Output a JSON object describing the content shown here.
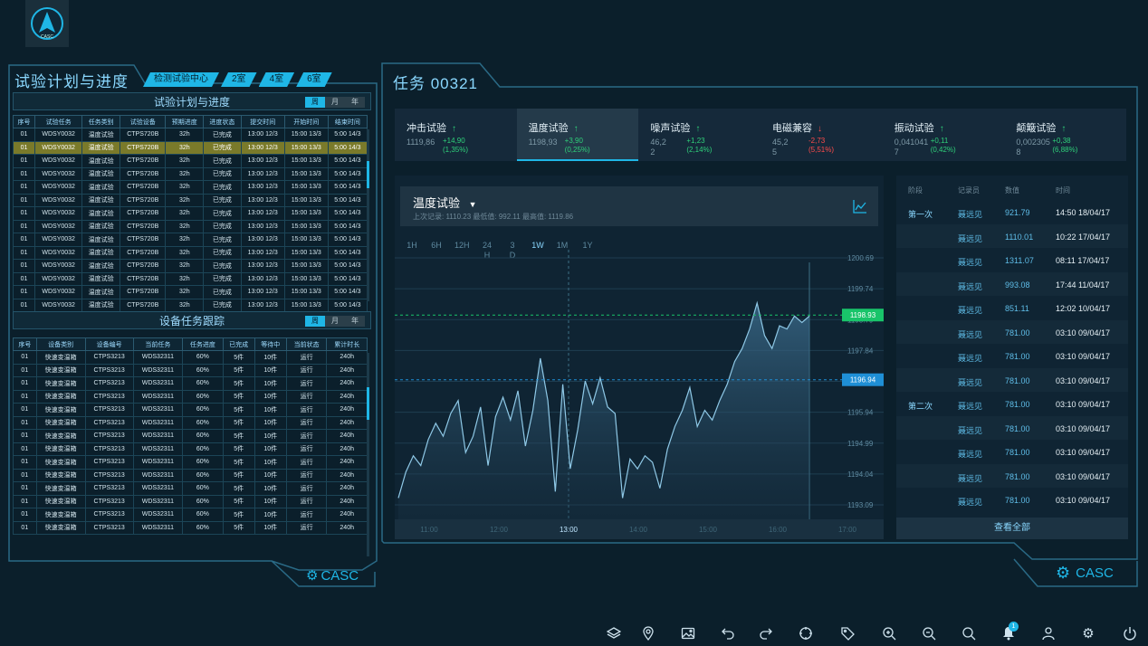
{
  "logo_text": "CASC",
  "left": {
    "title": "试验计划与进度",
    "tabs": [
      "检测试验中心",
      "2室",
      "4室",
      "6室"
    ],
    "footer": "CASC",
    "plan": {
      "title": "试验计划与进度",
      "seg": [
        "周",
        "月",
        "年"
      ],
      "cols": [
        "序号",
        "试验任务",
        "任务类别",
        "试验设备",
        "预期进度",
        "进度状态",
        "提交时间",
        "开始时间",
        "结束时间"
      ],
      "rows": [
        [
          "01",
          "WDSY0032",
          "温度试验",
          "CTPS720B",
          "32h",
          "已完成",
          "13:00 12/3",
          "15:00 13/3",
          "5:00 14/3"
        ],
        [
          "01",
          "WDSY0032",
          "温度试验",
          "CTPS720B",
          "32h",
          "已完成",
          "13:00 12/3",
          "15:00 13/3",
          "5:00 14/3"
        ],
        [
          "01",
          "WDSY0032",
          "温度试验",
          "CTPS720B",
          "32h",
          "已完成",
          "13:00 12/3",
          "15:00 13/3",
          "5:00 14/3"
        ],
        [
          "01",
          "WDSY0032",
          "温度试验",
          "CTPS720B",
          "32h",
          "已完成",
          "13:00 12/3",
          "15:00 13/3",
          "5:00 14/3"
        ],
        [
          "01",
          "WDSY0032",
          "温度试验",
          "CTPS720B",
          "32h",
          "已完成",
          "13:00 12/3",
          "15:00 13/3",
          "5:00 14/3"
        ],
        [
          "01",
          "WDSY0032",
          "温度试验",
          "CTPS720B",
          "32h",
          "已完成",
          "13:00 12/3",
          "15:00 13/3",
          "5:00 14/3"
        ],
        [
          "01",
          "WDSY0032",
          "温度试验",
          "CTPS720B",
          "32h",
          "已完成",
          "13:00 12/3",
          "15:00 13/3",
          "5:00 14/3"
        ],
        [
          "01",
          "WDSY0032",
          "温度试验",
          "CTPS720B",
          "32h",
          "已完成",
          "13:00 12/3",
          "15:00 13/3",
          "5:00 14/3"
        ],
        [
          "01",
          "WDSY0032",
          "温度试验",
          "CTPS720B",
          "32h",
          "已完成",
          "13:00 12/3",
          "15:00 13/3",
          "5:00 14/3"
        ],
        [
          "01",
          "WDSY0032",
          "温度试验",
          "CTPS720B",
          "32h",
          "已完成",
          "13:00 12/3",
          "15:00 13/3",
          "5:00 14/3"
        ],
        [
          "01",
          "WDSY0032",
          "温度试验",
          "CTPS720B",
          "32h",
          "已完成",
          "13:00 12/3",
          "15:00 13/3",
          "5:00 14/3"
        ],
        [
          "01",
          "WDSY0032",
          "温度试验",
          "CTPS720B",
          "32h",
          "已完成",
          "13:00 12/3",
          "15:00 13/3",
          "5:00 14/3"
        ],
        [
          "01",
          "WDSY0032",
          "温度试验",
          "CTPS720B",
          "32h",
          "已完成",
          "13:00 12/3",
          "15:00 13/3",
          "5:00 14/3"
        ],
        [
          "01",
          "WDSY0032",
          "温度试验",
          "CTPS720B",
          "32h",
          "已完成",
          "13:00 12/3",
          "15:00 13/3",
          "5:00 14/3"
        ]
      ],
      "highlight_row": 1
    },
    "device": {
      "title": "设备任务跟踪",
      "seg": [
        "周",
        "月",
        "年"
      ],
      "cols": [
        "序号",
        "设备类别",
        "设备编号",
        "当前任务",
        "任务进度",
        "已完成",
        "等待中",
        "当前状态",
        "累计时长"
      ],
      "rows": [
        [
          "01",
          "快速变温箱",
          "CTPS3213",
          "WDS32311",
          "60%",
          "5件",
          "10件",
          "运行",
          "240h"
        ],
        [
          "01",
          "快速变温箱",
          "CTPS3213",
          "WDS32311",
          "60%",
          "5件",
          "10件",
          "运行",
          "240h"
        ],
        [
          "01",
          "快速变温箱",
          "CTPS3213",
          "WDS32311",
          "60%",
          "5件",
          "10件",
          "运行",
          "240h"
        ],
        [
          "01",
          "快速变温箱",
          "CTPS3213",
          "WDS32311",
          "60%",
          "5件",
          "10件",
          "运行",
          "240h"
        ],
        [
          "01",
          "快速变温箱",
          "CTPS3213",
          "WDS32311",
          "60%",
          "5件",
          "10件",
          "运行",
          "240h"
        ],
        [
          "01",
          "快速变温箱",
          "CTPS3213",
          "WDS32311",
          "60%",
          "5件",
          "10件",
          "运行",
          "240h"
        ],
        [
          "01",
          "快速变温箱",
          "CTPS3213",
          "WDS32311",
          "60%",
          "5件",
          "10件",
          "运行",
          "240h"
        ],
        [
          "01",
          "快速变温箱",
          "CTPS3213",
          "WDS32311",
          "60%",
          "5件",
          "10件",
          "运行",
          "240h"
        ],
        [
          "01",
          "快速变温箱",
          "CTPS3213",
          "WDS32311",
          "60%",
          "5件",
          "10件",
          "运行",
          "240h"
        ],
        [
          "01",
          "快速变温箱",
          "CTPS3213",
          "WDS32311",
          "60%",
          "5件",
          "10件",
          "运行",
          "240h"
        ],
        [
          "01",
          "快速变温箱",
          "CTPS3213",
          "WDS32311",
          "60%",
          "5件",
          "10件",
          "运行",
          "240h"
        ],
        [
          "01",
          "快速变温箱",
          "CTPS3213",
          "WDS32311",
          "60%",
          "5件",
          "10件",
          "运行",
          "240h"
        ],
        [
          "01",
          "快速变温箱",
          "CTPS3213",
          "WDS32311",
          "60%",
          "5件",
          "10件",
          "运行",
          "240h"
        ],
        [
          "01",
          "快速变温箱",
          "CTPS3213",
          "WDS32311",
          "60%",
          "5件",
          "10件",
          "运行",
          "240h"
        ]
      ]
    }
  },
  "right": {
    "title": "任务 00321",
    "footer": "CASC",
    "tests": [
      {
        "name": "冲击试验",
        "dir": "up",
        "val": "1119,86",
        "sub": "",
        "d1": "+14,90",
        "d2": "(1,35%)"
      },
      {
        "name": "温度试验",
        "dir": "up",
        "val": "1198,93",
        "sub": "",
        "d1": "+3,90",
        "d2": "(0,25%)",
        "active": true
      },
      {
        "name": "噪声试验",
        "dir": "up",
        "val": "46,2",
        "sub": "2",
        "d1": "+1,23",
        "d2": "(2,14%)"
      },
      {
        "name": "电磁兼容",
        "dir": "down",
        "val": "45,2",
        "sub": "5",
        "d1": "-2,73",
        "d2": "(5,51%)"
      },
      {
        "name": "振动试验",
        "dir": "up",
        "val": "0,041041",
        "sub": "7",
        "d1": "+0,11",
        "d2": "(0,42%)"
      },
      {
        "name": "颠簸试验",
        "dir": "up",
        "val": "0,002305",
        "sub": "8",
        "d1": "+0,38",
        "d2": "(6,88%)"
      }
    ],
    "chart_head": {
      "title": "温度试验",
      "stats": "上次记录: 1110.23    最低值: 992.11    最高值: 1119.86"
    },
    "timeframes": [
      "1H",
      "6H",
      "12H",
      "24\nH",
      "3\nD",
      "1W",
      "1M",
      "1Y"
    ],
    "active_tf": "1W",
    "records": {
      "cols": [
        "阶段",
        "记录员",
        "数值",
        "时间"
      ],
      "rows": [
        [
          "第一次",
          "聂远见",
          "921.79",
          "14:50  18/04/17"
        ],
        [
          "",
          "聂远见",
          "1110.01",
          "10:22 17/04/17"
        ],
        [
          "",
          "聂远见",
          "1311.07",
          "08:11 17/04/17"
        ],
        [
          "",
          "聂远见",
          "993.08",
          "17:44 11/04/17"
        ],
        [
          "",
          "聂远见",
          "851.11",
          "12:02 10/04/17"
        ],
        [
          "",
          "聂远见",
          "781.00",
          "03:10 09/04/17"
        ],
        [
          "",
          "聂远见",
          "781.00",
          "03:10 09/04/17"
        ],
        [
          "",
          "聂远见",
          "781.00",
          "03:10 09/04/17"
        ],
        [
          "第二次",
          "聂远见",
          "781.00",
          "03:10 09/04/17"
        ],
        [
          "",
          "聂远见",
          "781.00",
          "03:10 09/04/17"
        ],
        [
          "",
          "聂远见",
          "781.00",
          "03:10 09/04/17"
        ],
        [
          "",
          "聂远见",
          "781.00",
          "03:10 09/04/17"
        ],
        [
          "",
          "聂远见",
          "781.00",
          "03:10 09/04/17"
        ]
      ],
      "view_all": "查看全部"
    }
  },
  "notification_count": "1",
  "chart_data": {
    "type": "area",
    "title": "温度试验",
    "xlabel": "",
    "ylabel": "",
    "x_ticks": [
      "11:00",
      "12:00",
      "13:00",
      "14:00",
      "15:00",
      "16:00",
      "17:00"
    ],
    "y_ticks": [
      1200.69,
      1199.74,
      1198.79,
      1197.84,
      1196.89,
      1195.94,
      1194.99,
      1194.04,
      1193.09
    ],
    "ylim": [
      1193.09,
      1200.69
    ],
    "markers": [
      {
        "label": "1198.93",
        "value": 1198.93,
        "color": "#19c46a"
      },
      {
        "label": "1196.94",
        "value": 1196.94,
        "color": "#1f8fd6"
      }
    ],
    "series": [
      {
        "values": [
          1193.3,
          1194.1,
          1194.6,
          1194.3,
          1195.1,
          1195.6,
          1195.2,
          1195.9,
          1196.3,
          1194.7,
          1195.2,
          1196.1,
          1194.3,
          1195.8,
          1196.4,
          1195.7,
          1196.6,
          1194.9,
          1196.0,
          1197.6,
          1196.3,
          1193.5,
          1196.8,
          1194.2,
          1195.4,
          1196.9,
          1196.2,
          1197.0,
          1196.1,
          1195.9,
          1193.3,
          1194.5,
          1194.2,
          1194.6,
          1194.4,
          1193.6,
          1194.8,
          1195.5,
          1196.0,
          1196.7,
          1195.5,
          1196.0,
          1195.7,
          1196.3,
          1196.8,
          1197.5,
          1197.9,
          1198.5,
          1199.3,
          1198.3,
          1197.9,
          1198.6,
          1198.5,
          1198.9,
          1198.7,
          1198.9
        ]
      }
    ]
  }
}
